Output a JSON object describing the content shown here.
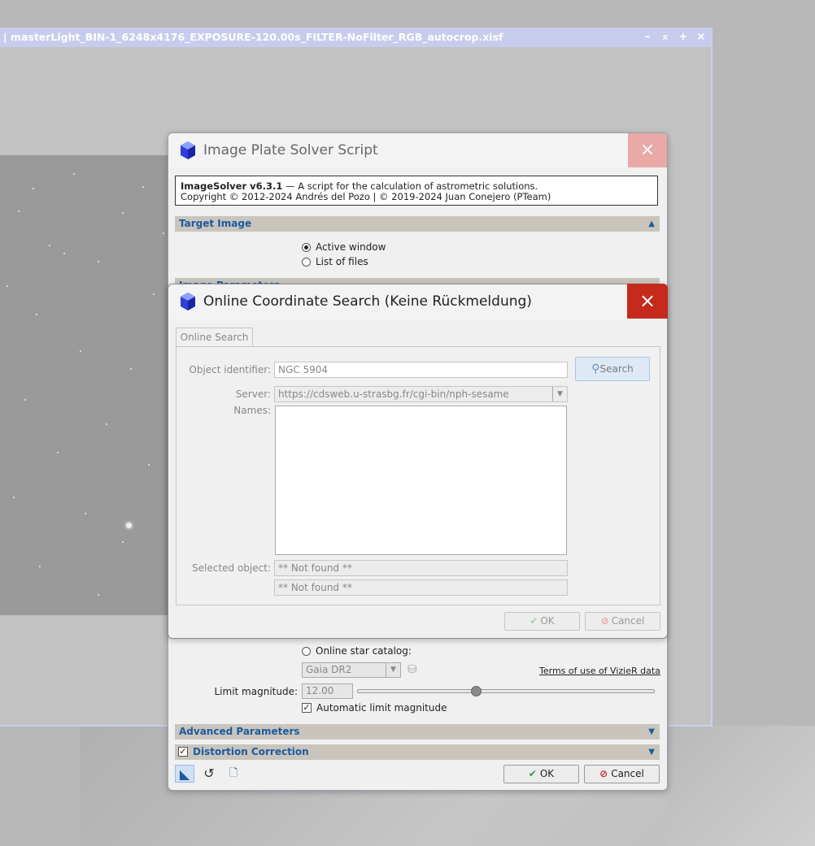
{
  "image_window": {
    "title": "| masterLight_BIN-1_6248x4176_EXPOSURE-120.00s_FILTER-NoFilter_RGB_autocrop.xisf",
    "buttons": [
      "–",
      "⌅",
      "+",
      "×"
    ]
  },
  "solver_dialog": {
    "title": "Image Plate Solver Script",
    "close_symbol": "×",
    "info": {
      "name_version": "ImageSolver v6.3.1",
      "description": " — A script for the calculation of astrometric solutions.",
      "copyright": "Copyright © 2012-2024 Andrés del Pozo | © 2019-2024 Juan Conejero (PTeam)"
    },
    "sections": {
      "target_image": "Target Image",
      "image_parameters": "Image Parameters",
      "advanced_parameters": "Advanced Parameters",
      "distortion_correction": "Distortion Correction"
    },
    "target_options": [
      {
        "label": "Active window",
        "selected": true
      },
      {
        "label": "List of files",
        "selected": false
      }
    ],
    "online_star_catalog_label": "Online star catalog:",
    "catalog_value": "Gaia DR2",
    "terms_link": "Terms of use of VizieR data",
    "limit_magnitude_label": "Limit magnitude:",
    "limit_magnitude_value": "12.00",
    "limit_magnitude_slider": 0.4,
    "auto_limit_label": "Automatic limit magnitude",
    "auto_limit_checked": true,
    "distortion_checked": true,
    "ok_label": "OK",
    "cancel_label": "Cancel"
  },
  "search_dialog": {
    "title": "Online Coordinate Search (Keine Rückmeldung)",
    "close_symbol": "×",
    "tab_label": "Online Search",
    "object_identifier_label": "Object identifier:",
    "object_identifier_value": "NGC 5904",
    "search_button_label": "Search",
    "server_label": "Server:",
    "server_value": "https://cdsweb.u-strasbg.fr/cgi-bin/nph-sesame",
    "names_label": "Names:",
    "selected_object_label": "Selected object:",
    "selected_object_value": "** Not found **",
    "selected_object_value2": "** Not found **",
    "ok_label": "OK",
    "cancel_label": "Cancel"
  },
  "colors": {
    "accent_blue": "#1d5a9e",
    "close_red": "#c42b1c",
    "close_red_inactive": "#e8a9a7",
    "window_title_bar": "#c8ccec"
  },
  "icons": {
    "app_logo": "pixinsight-cube-icon",
    "search": "magnifier-icon",
    "ok": "checkmark-icon",
    "cancel": "no-entry-icon",
    "new_instance": "triangle-icon",
    "reset": "reset-icon",
    "documentation": "document-icon",
    "expand": "double-chevron-down-icon",
    "collapse": "double-chevron-up-icon"
  }
}
